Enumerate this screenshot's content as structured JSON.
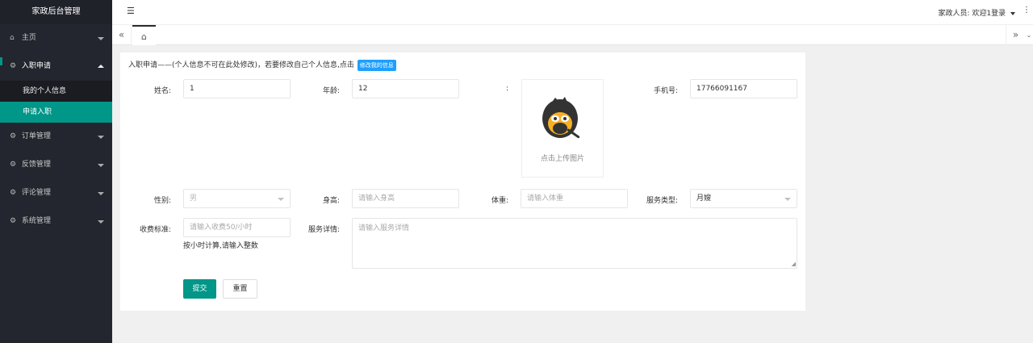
{
  "app": {
    "title": "家政后台管理"
  },
  "sidebar": {
    "items": [
      {
        "label": "主页",
        "icon": "home-icon",
        "glyph": "⌂"
      },
      {
        "label": "入职申请",
        "icon": "gear-icon",
        "glyph": "⚙",
        "open": true,
        "children": [
          {
            "label": "我的个人信息"
          },
          {
            "label": "申请入职",
            "active": true
          }
        ]
      },
      {
        "label": "订单管理",
        "icon": "gear-icon",
        "glyph": "⚙"
      },
      {
        "label": "反馈管理",
        "icon": "gear-icon",
        "glyph": "⚙"
      },
      {
        "label": "评论管理",
        "icon": "gear-icon",
        "glyph": "⚙"
      },
      {
        "label": "系统管理",
        "icon": "settings-icon",
        "glyph": "⚙"
      }
    ]
  },
  "header": {
    "fold_glyph": "☰",
    "user_label": "家政人员: 欢迎1登录",
    "more_glyph": "⋮"
  },
  "tabs": {
    "prev_glyph": "«",
    "home_glyph": "⌂",
    "next_glyph": "»",
    "down_glyph": "⌄"
  },
  "form": {
    "notice": "入职申请——(个人信息不可在此处修改)，若要修改自己个人信息,点击",
    "edit_button": "修改我的信息",
    "name": {
      "label": "姓名:",
      "value": "1"
    },
    "age": {
      "label": "年龄:",
      "value": "12"
    },
    "photo": {
      "label": ":",
      "upload_text": "点击上传图片"
    },
    "phone": {
      "label": "手机号:",
      "value": "17766091167"
    },
    "gender": {
      "label": "性别:",
      "value": "男"
    },
    "height": {
      "label": "身高:",
      "placeholder": "请输入身高"
    },
    "weight": {
      "label": "体重:",
      "placeholder": "请输入体重"
    },
    "service_type": {
      "label": "服务类型:",
      "value": "月嫂"
    },
    "fee": {
      "label": "收费标准:",
      "placeholder": "请输入收费50/小时",
      "hint": "按小时计算,请输入整数"
    },
    "service_detail": {
      "label": "服务详情:",
      "placeholder": "请输入服务详情"
    },
    "submit_label": "提交",
    "reset_label": "重置"
  },
  "colors": {
    "sidebar_bg": "#23262e",
    "accent": "#009688",
    "link_btn": "#1e9fff"
  }
}
